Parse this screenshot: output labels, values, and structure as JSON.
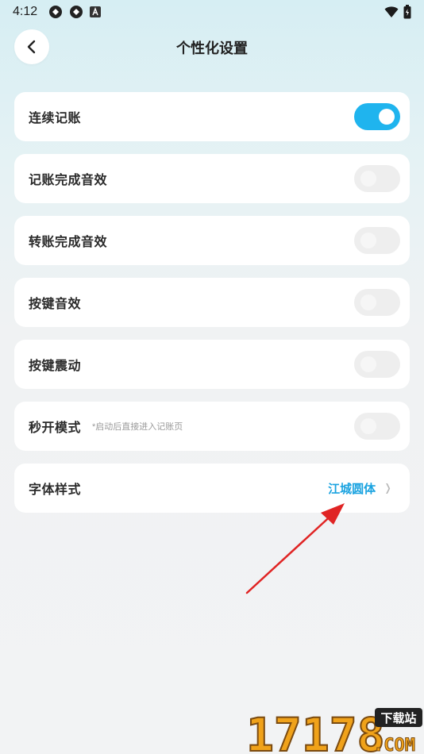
{
  "status_bar": {
    "time": "4:12",
    "left_icons": [
      "sync-icon",
      "sync-icon",
      "a-icon"
    ],
    "right_icons": [
      "wifi-icon",
      "battery-icon"
    ]
  },
  "header": {
    "title": "个性化设置",
    "back_icon": "chevron-left-icon"
  },
  "settings": [
    {
      "label": "连续记账",
      "hint": "",
      "type": "toggle",
      "on": true
    },
    {
      "label": "记账完成音效",
      "hint": "",
      "type": "toggle",
      "on": false
    },
    {
      "label": "转账完成音效",
      "hint": "",
      "type": "toggle",
      "on": false
    },
    {
      "label": "按键音效",
      "hint": "",
      "type": "toggle",
      "on": false
    },
    {
      "label": "按键震动",
      "hint": "",
      "type": "toggle",
      "on": false
    },
    {
      "label": "秒开模式",
      "hint": "*启动后直接进入记账页",
      "type": "toggle",
      "on": false
    },
    {
      "label": "字体样式",
      "value": "江城圆体",
      "type": "link"
    }
  ],
  "colors": {
    "accent": "#1fb4ee",
    "value_text": "#1aa3e0",
    "annotation_arrow": "#e02424"
  },
  "watermark": {
    "digits": "17178",
    "badge": "下载站",
    "suffix": ".COM"
  }
}
